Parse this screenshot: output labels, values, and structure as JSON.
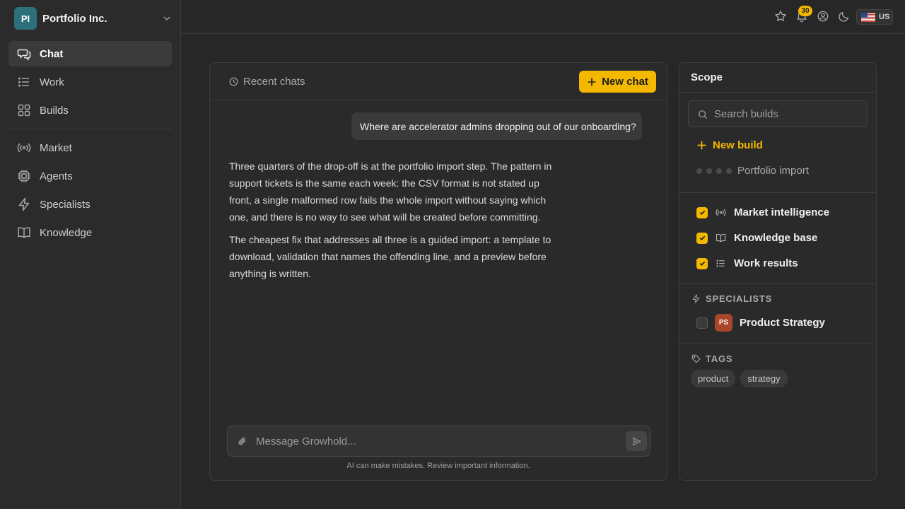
{
  "org": {
    "initials": "PI",
    "name": "Portfolio Inc."
  },
  "nav": {
    "primary": [
      {
        "label": "Chat",
        "icon": "chat-icon",
        "active": true
      },
      {
        "label": "Work",
        "icon": "list-icon"
      },
      {
        "label": "Builds",
        "icon": "grid-icon"
      }
    ],
    "secondary": [
      {
        "label": "Market",
        "icon": "broadcast-icon"
      },
      {
        "label": "Agents",
        "icon": "chip-icon"
      },
      {
        "label": "Specialists",
        "icon": "bolt-icon"
      },
      {
        "label": "Knowledge",
        "icon": "book-icon"
      }
    ]
  },
  "topbar": {
    "notification_count": "30",
    "locale": "US"
  },
  "chat": {
    "recent_label": "Recent chats",
    "new_chat_label": "New chat",
    "user_message": "Where are accelerator admins dropping out of our onboarding?",
    "assistant_paragraphs": [
      "Three quarters of the drop-off is at the portfolio import step. The pattern in support tickets is the same each week: the CSV format is not stated up front, a single malformed row fails the whole import without saying which one, and there is no way to see what will be created before committing.",
      "The cheapest fix that addresses all three is a guided import: a template to download, validation that names the offending line, and a preview before anything is written."
    ],
    "composer_placeholder": "Message Growhold...",
    "disclaimer": "AI can make mistakes. Review important information."
  },
  "scope": {
    "title": "Scope",
    "search_placeholder": "Search builds",
    "new_build_label": "New build",
    "build_item": "Portfolio import",
    "sources": [
      {
        "label": "Market intelligence",
        "icon": "broadcast-icon",
        "checked": true
      },
      {
        "label": "Knowledge base",
        "icon": "book-icon",
        "checked": true
      },
      {
        "label": "Work results",
        "icon": "list-icon",
        "checked": true
      }
    ],
    "specialists_heading": "SPECIALISTS",
    "specialist": {
      "initials": "PS",
      "name": "Product Strategy",
      "checked": false
    },
    "tags_heading": "TAGS",
    "tags": [
      "product",
      "strategy"
    ]
  },
  "colors": {
    "accent": "#f5b800",
    "org_avatar": "#2e6f7c",
    "specialist_avatar": "#a94528",
    "background": "#272727"
  }
}
